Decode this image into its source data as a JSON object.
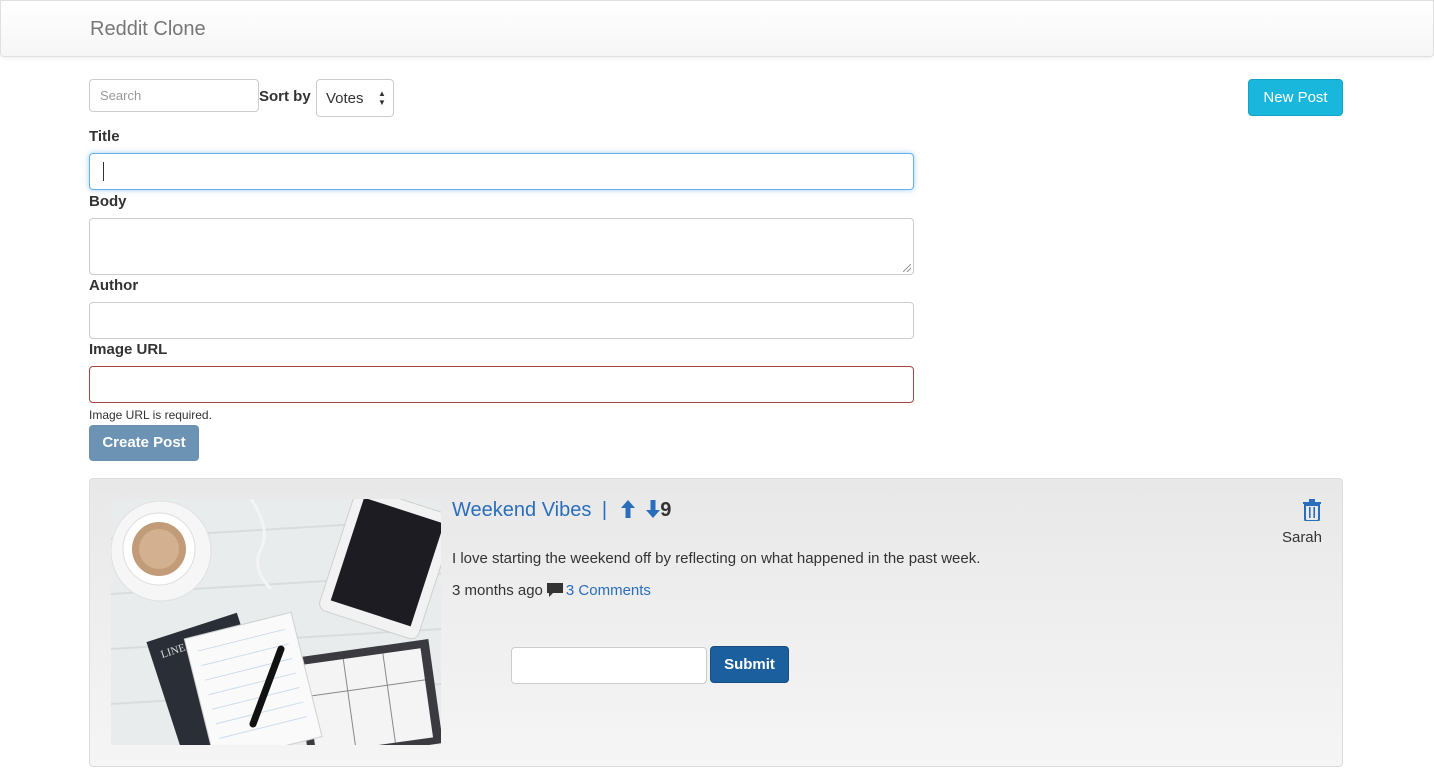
{
  "navbar": {
    "brand": "Reddit Clone"
  },
  "toolbar": {
    "search_placeholder": "Search",
    "sort_label": "Sort by",
    "sort_value": "Votes",
    "new_post_label": "New Post"
  },
  "form": {
    "title_label": "Title",
    "body_label": "Body",
    "author_label": "Author",
    "image_label": "Image URL",
    "image_error": "Image URL is required.",
    "create_label": "Create Post"
  },
  "post": {
    "title": "Weekend Vibes",
    "separator": "|",
    "votes": "9",
    "body": "I love starting the weekend off by reflecting on what happened in the past week.",
    "time_ago": "3 months ago",
    "comments_link": "3 Comments",
    "author": "Sarah",
    "submit_label": "Submit"
  },
  "colors": {
    "link": "#2a6ebb",
    "new_post_button": "#1ab7dd",
    "submit_button": "#1c5f9e",
    "create_button": "#6c93b3",
    "error_border": "#a94442"
  },
  "icons": {
    "vote_up": "arrow-up-icon",
    "vote_down": "arrow-down-icon",
    "comment": "comment-icon",
    "delete": "trash-icon"
  }
}
